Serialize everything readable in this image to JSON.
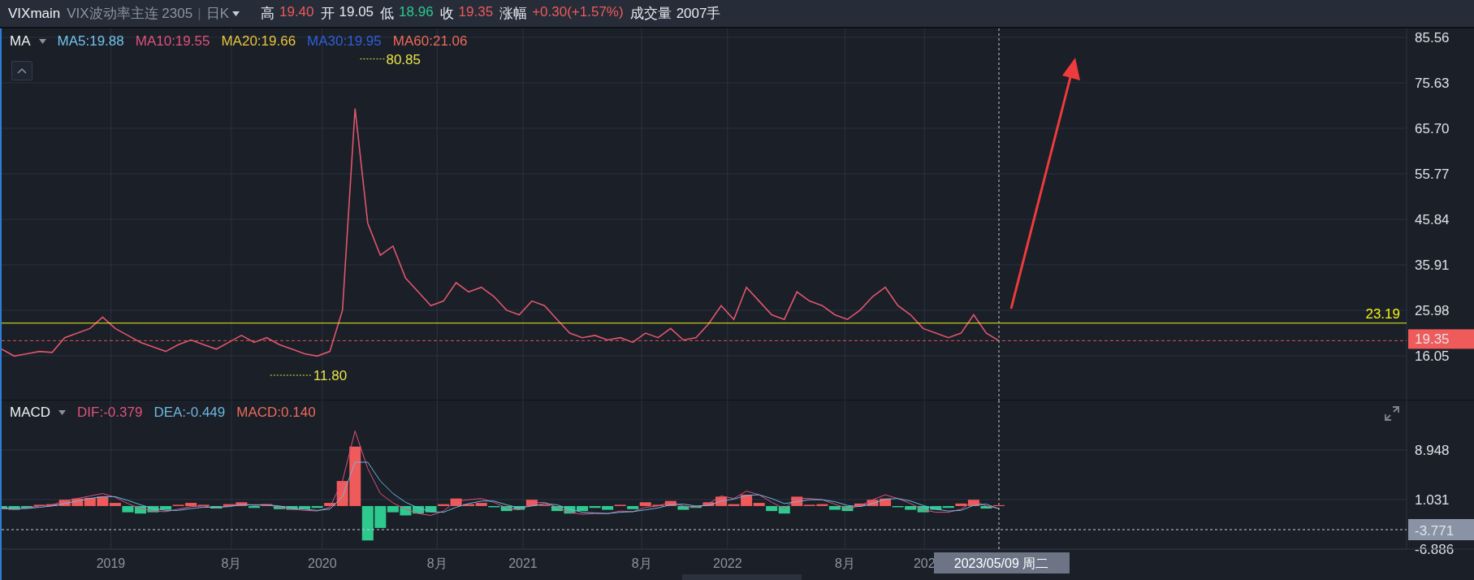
{
  "header": {
    "symbol": "VIXmain",
    "name": "VIX波动率主连 2305",
    "separator": "|",
    "period": "日K",
    "quotes": [
      {
        "label": "高",
        "value": "19.40",
        "color": "#f0595a"
      },
      {
        "label": "开",
        "value": "19.05",
        "color": "#e6e9ee"
      },
      {
        "label": "低",
        "value": "18.96",
        "color": "#2ec98f"
      },
      {
        "label": "收",
        "value": "19.35",
        "color": "#f0595a"
      },
      {
        "label": "涨幅",
        "value": "+0.30(+1.57%)",
        "color": "#f0595a"
      },
      {
        "label": "成交量",
        "value": "2007手",
        "color": "#e6e9ee"
      }
    ]
  },
  "price_panel": {
    "indicator": "MA",
    "legend": [
      {
        "text": "MA5:19.88",
        "color": "#73c3ec"
      },
      {
        "text": "MA10:19.55",
        "color": "#e0527c"
      },
      {
        "text": "MA20:19.66",
        "color": "#e9c53c"
      },
      {
        "text": "MA30:19.95",
        "color": "#2f60d8"
      },
      {
        "text": "MA60:21.06",
        "color": "#ef6a5a"
      }
    ],
    "axis_labels": [
      "85.56",
      "75.63",
      "65.70",
      "55.77",
      "45.84",
      "35.91",
      "25.98",
      "16.05"
    ],
    "max_label": "80.85",
    "min_label": "11.80",
    "line_label": "23.19",
    "last_price": "19.35"
  },
  "macd_panel": {
    "indicator": "MACD",
    "legend": [
      {
        "text": "DIF:-0.379",
        "color": "#e0527c"
      },
      {
        "text": "DEA:-0.449",
        "color": "#6fb7e0"
      },
      {
        "text": "MACD:0.140",
        "color": "#ef6a5a"
      }
    ],
    "axis_labels": [
      "8.948",
      "1.031",
      "-6.886"
    ]
  },
  "time_axis": [
    "2019",
    "8月",
    "2020",
    "8月",
    "2021",
    "8月",
    "2022",
    "8月",
    "202"
  ],
  "crosshair": {
    "date": "2023/05/09 周二",
    "value": "-3.771"
  }
}
